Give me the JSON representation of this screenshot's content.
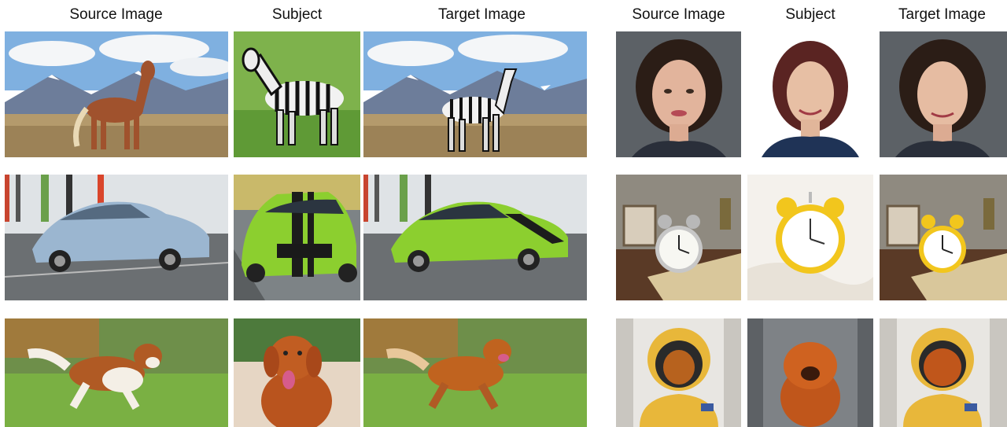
{
  "headers": {
    "left": [
      "Source Image",
      "Subject",
      "Target Image"
    ],
    "right": [
      "Source Image",
      "Subject",
      "Target Image"
    ]
  },
  "rows_left": [
    {
      "source": "Horse standing in a meadow with snowy mountains",
      "subject": "Zebra on green grass",
      "target": "Zebra standing in the meadow with snowy mountains"
    },
    {
      "source": "Light blue sedan driving on a road",
      "subject": "Lime green sports car with black stripes",
      "target": "Lime green sports car driving on the road"
    },
    {
      "source": "Brown and white dog running on grass",
      "subject": "Golden retriever sitting on sand",
      "target": "Golden dog running on grass"
    }
  ],
  "rows_right": [
    {
      "source": "Portrait of a young woman",
      "subject": "Portrait of a woman in navy top",
      "target": "Portrait of the woman on grey background"
    },
    {
      "source": "Silver alarm clock on a table",
      "subject": "Yellow alarm clock on white fabric",
      "target": "Yellow alarm clock on the table"
    },
    {
      "source": "Dog in an astronaut suit",
      "subject": "Fluffy chow chow dog",
      "target": "Chow chow in an astronaut suit"
    }
  ]
}
